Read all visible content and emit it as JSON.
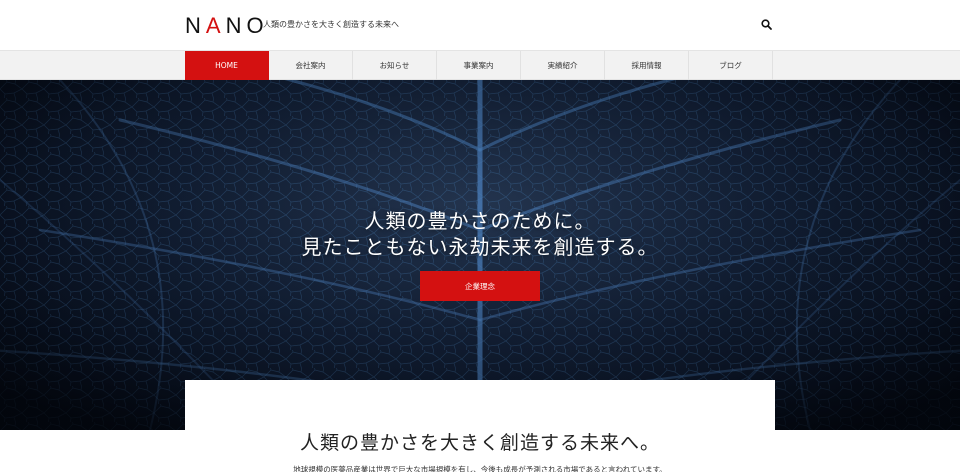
{
  "header": {
    "logo": "NANO",
    "tagline": "人類の豊かさを大きく創造する未来へ",
    "search_icon": "search-icon"
  },
  "nav": {
    "items": [
      {
        "label": "HOME",
        "active": true
      },
      {
        "label": "会社案内"
      },
      {
        "label": "お知らせ"
      },
      {
        "label": "事業案内"
      },
      {
        "label": "実績紹介"
      },
      {
        "label": "採用情報"
      },
      {
        "label": "ブログ"
      }
    ]
  },
  "hero": {
    "line1": "人類の豊かさのために。",
    "line2": "見たこともない永劫未来を創造する。",
    "button_label": "企業理念"
  },
  "intro": {
    "title": "人類の豊かさを大きく創造する未来へ。",
    "text": "地球規模の医薬品産業は世界で巨大な市場規模を有し、今後も成長が予測される市場であると言われています。"
  },
  "colors": {
    "accent": "#d41111",
    "hero_dark": "#0b1528",
    "vein": "#4f86c6"
  }
}
